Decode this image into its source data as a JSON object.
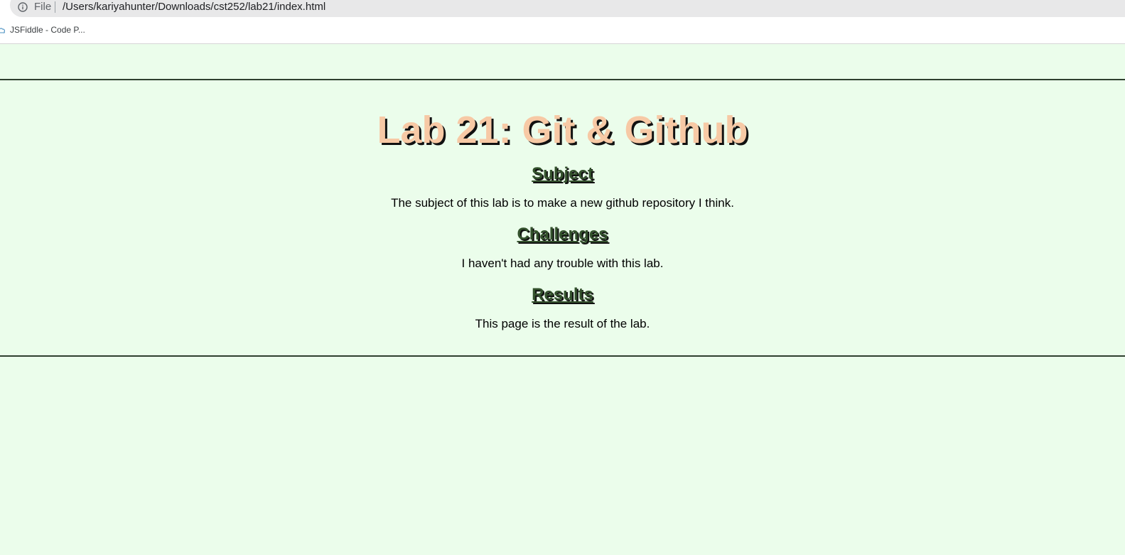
{
  "browser": {
    "file_label": "File",
    "url": "/Users/kariyahunter/Downloads/cst252/lab21/index.html",
    "bookmarks": [
      {
        "label": "JSFiddle - Code P...",
        "icon": "jsfiddle-icon"
      }
    ]
  },
  "page": {
    "title": "Lab 21: Git & Github",
    "sections": [
      {
        "heading": "Subject",
        "text": "The subject of this lab is to make a new github repository I think."
      },
      {
        "heading": "Challenges",
        "text": "I haven't had any trouble with this lab."
      },
      {
        "heading": "Results",
        "text": "This page is the result of the lab."
      }
    ]
  },
  "colors": {
    "background": "#ebfdeb",
    "title": "#f7c9a5",
    "heading": "#33512c",
    "border": "#2f3f2f"
  }
}
